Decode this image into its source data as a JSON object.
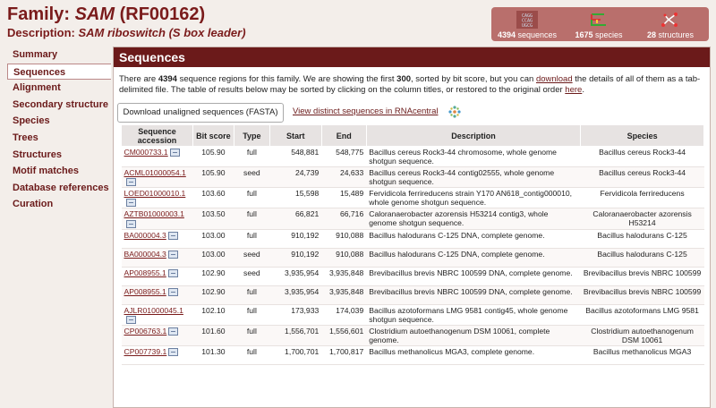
{
  "header": {
    "family_label": "Family:",
    "family_name": "SAM",
    "family_acc": "(RF00162)",
    "desc_label": "Description:",
    "desc_text": "SAM riboswitch (S box leader)"
  },
  "stats": [
    {
      "count": "4394",
      "label": "sequences",
      "icon": "sequences-icon"
    },
    {
      "count": "1675",
      "label": "species",
      "icon": "species-icon"
    },
    {
      "count": "28",
      "label": "structures",
      "icon": "structures-icon"
    }
  ],
  "stat_icon_text": "CAGG CCAG UGCGGU",
  "sidebar": {
    "items": [
      {
        "label": "Summary"
      },
      {
        "label": "Sequences"
      },
      {
        "label": "Alignment"
      },
      {
        "label": "Secondary structure"
      },
      {
        "label": "Species"
      },
      {
        "label": "Trees"
      },
      {
        "label": "Structures"
      },
      {
        "label": "Motif matches"
      },
      {
        "label": "Database references"
      },
      {
        "label": "Curation"
      }
    ]
  },
  "main": {
    "title": "Sequences",
    "intro_1": "There are ",
    "intro_count": "4394",
    "intro_2": " sequence regions for this family. We are showing the first ",
    "intro_first": "300",
    "intro_3": ", sorted by bit score, but you can ",
    "intro_download": "download",
    "intro_4": " the details of all of them as a tab-delimited file. The table of results below may be sorted by clicking on the column titles, or restored to the original order ",
    "intro_here": "here",
    "intro_5": ".",
    "download_button": "Download unaligned sequences (FASTA)",
    "rnacentral_link": "View distinct sequences in RNAcentral"
  },
  "table": {
    "headers": [
      "Sequence accession",
      "Bit score",
      "Type",
      "Start",
      "End",
      "Description",
      "Species"
    ],
    "rows": [
      {
        "acc": "CM000733.1",
        "score": "105.90",
        "type": "full",
        "start": "548,881",
        "end": "548,775",
        "desc": "Bacillus cereus Rock3-44 chromosome, whole genome shotgun sequence.",
        "species": "Bacillus cereus Rock3-44"
      },
      {
        "acc": "ACML01000054.1",
        "score": "105.90",
        "type": "seed",
        "start": "24,739",
        "end": "24,633",
        "desc": "Bacillus cereus Rock3-44 contig02555, whole genome shotgun sequence.",
        "species": "Bacillus cereus Rock3-44"
      },
      {
        "acc": "LOED01000010.1",
        "score": "103.60",
        "type": "full",
        "start": "15,598",
        "end": "15,489",
        "desc": "Fervidicola ferrireducens strain Y170 AN618_contig000010, whole genome shotgun sequence.",
        "species": "Fervidicola ferrireducens"
      },
      {
        "acc": "AZTB01000003.1",
        "score": "103.50",
        "type": "full",
        "start": "66,821",
        "end": "66,716",
        "desc": "Caloranaerobacter azorensis H53214 contig3, whole genome shotgun sequence.",
        "species": "Caloranaerobacter azorensis H53214"
      },
      {
        "acc": "BA000004.3",
        "score": "103.00",
        "type": "full",
        "start": "910,192",
        "end": "910,088",
        "desc": "Bacillus halodurans C-125 DNA, complete genome.",
        "species": "Bacillus halodurans C-125"
      },
      {
        "acc": "BA000004.3",
        "score": "103.00",
        "type": "seed",
        "start": "910,192",
        "end": "910,088",
        "desc": "Bacillus halodurans C-125 DNA, complete genome.",
        "species": "Bacillus halodurans C-125"
      },
      {
        "acc": "AP008955.1",
        "score": "102.90",
        "type": "seed",
        "start": "3,935,954",
        "end": "3,935,848",
        "desc": "Brevibacillus brevis NBRC 100599 DNA, complete genome.",
        "species": "Brevibacillus brevis NBRC 100599"
      },
      {
        "acc": "AP008955.1",
        "score": "102.90",
        "type": "full",
        "start": "3,935,954",
        "end": "3,935,848",
        "desc": "Brevibacillus brevis NBRC 100599 DNA, complete genome.",
        "species": "Brevibacillus brevis NBRC 100599"
      },
      {
        "acc": "AJLR01000045.1",
        "score": "102.10",
        "type": "full",
        "start": "173,933",
        "end": "174,039",
        "desc": "Bacillus azotoformans LMG 9581 contig45, whole genome shotgun sequence.",
        "species": "Bacillus azotoformans LMG 9581"
      },
      {
        "acc": "CP006763.1",
        "score": "101.60",
        "type": "full",
        "start": "1,556,701",
        "end": "1,556,601",
        "desc": "Clostridium autoethanogenum DSM 10061, complete genome.",
        "species": "Clostridium autoethanogenum DSM 10061"
      },
      {
        "acc": "CP007739.1",
        "score": "101.30",
        "type": "full",
        "start": "1,700,701",
        "end": "1,700,817",
        "desc": "Bacillus methanolicus MGA3, complete genome.",
        "species": "Bacillus methanolicus MGA3"
      }
    ]
  },
  "colors": {
    "brand": "#6b1a1a",
    "stats_bg": "#b96f6c"
  }
}
